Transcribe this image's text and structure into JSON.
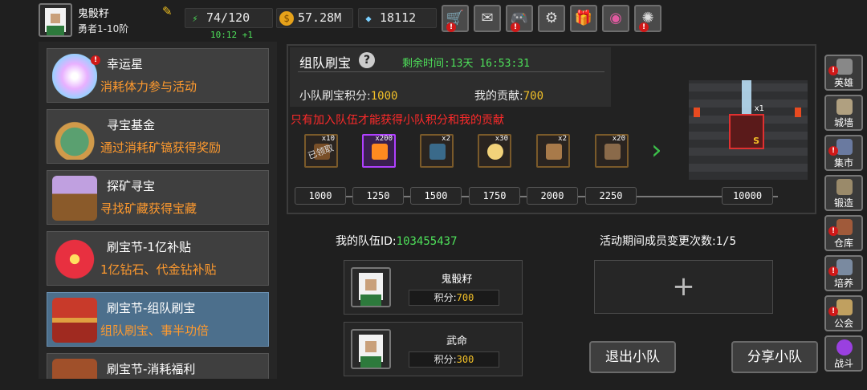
{
  "player": {
    "name": "鬼骰籽",
    "rank": "勇者1-10阶"
  },
  "stats": {
    "stamina": "74/120",
    "stamina_timer": "10:12 +1",
    "gold": "57.28M",
    "diamonds": "18112"
  },
  "toolbar": {
    "icons": [
      "shop-cart-icon",
      "mail-icon",
      "gamepad-icon",
      "settings-gear-icon",
      "gift-icon",
      "color-wheel-icon",
      "fireworks-icon"
    ]
  },
  "sidebar": {
    "items": [
      {
        "title": "幸运星",
        "subtitle": "消耗体力参与活动"
      },
      {
        "title": "寻宝基金",
        "subtitle": "通过消耗矿镐获得奖励"
      },
      {
        "title": "探矿寻宝",
        "subtitle": "寻找矿藏获得宝藏"
      },
      {
        "title": "刷宝节-1亿补贴",
        "subtitle": "1亿钻石、代金钻补贴"
      },
      {
        "title": "刷宝节-组队刷宝",
        "subtitle": "组队刷宝、事半功倍"
      },
      {
        "title": "刷宝节-消耗福利",
        "subtitle": ""
      }
    ]
  },
  "event": {
    "title": "组队刷宝",
    "remaining_label": "剩余时间:",
    "remaining_value": "13天 16:53:31",
    "team_score_label": "小队刷宝积分:",
    "team_score": "1000",
    "my_contrib_label": "我的贡献:",
    "my_contrib": "700",
    "warning": "只有加入队伍才能获得小队积分和我的贡献",
    "rewards": [
      {
        "count": "x10",
        "claimed": "已领取",
        "color": "#c87a30"
      },
      {
        "count": "x200",
        "color": "#ff8a20"
      },
      {
        "count": "x2",
        "color": "#3a6a8a"
      },
      {
        "count": "x30",
        "color": "#f2d27a"
      },
      {
        "count": "x2",
        "color": "#a87a4a"
      },
      {
        "count": "x20",
        "color": "#8a6a4a"
      }
    ],
    "milestones": [
      "1000",
      "1250",
      "1500",
      "1750",
      "2000",
      "2250",
      "10000"
    ],
    "grand_prize_count": "x1",
    "grand_prize_grade": "S"
  },
  "team": {
    "id_label": "我的队伍ID:",
    "id_value": "103455437",
    "changes_label": "活动期间成员变更次数:",
    "changes_value": "1/5",
    "members": [
      {
        "name": "鬼骰籽",
        "score_label": "积分:",
        "score": "700"
      },
      {
        "name": "武命",
        "score_label": "积分:",
        "score": "300"
      }
    ],
    "add_symbol": "+",
    "leave_button": "退出小队",
    "share_button": "分享小队"
  },
  "rightnav": {
    "items": [
      {
        "label": "英雄",
        "alert": true
      },
      {
        "label": "城墙",
        "alert": false
      },
      {
        "label": "集市",
        "alert": true
      },
      {
        "label": "锻造",
        "alert": false
      },
      {
        "label": "仓库",
        "alert": true
      },
      {
        "label": "培养",
        "alert": true
      },
      {
        "label": "公会",
        "alert": true
      },
      {
        "label": "战斗",
        "alert": false
      }
    ]
  },
  "alert_symbol": "!"
}
